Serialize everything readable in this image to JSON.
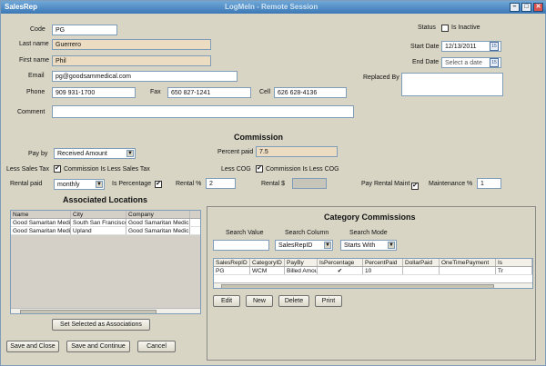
{
  "window": {
    "title": "SalesRep",
    "ghost_title": "LogMeIn - Remote Session"
  },
  "controls": {
    "min": "–",
    "max": "□",
    "close": "✕"
  },
  "form": {
    "code_label": "Code",
    "code_value": "PG",
    "lastname_label": "Last name",
    "lastname_value": "Guerrero",
    "firstname_label": "First name",
    "firstname_value": "Phil",
    "email_label": "Email",
    "email_value": "pg@goodsammedical.com",
    "phone_label": "Phone",
    "phone_value": "909 931-1700",
    "fax_label": "Fax",
    "fax_value": "650 827-1241",
    "cell_label": "Cell",
    "cell_value": "626 628-4136",
    "comment_label": "Comment",
    "comment_value": "",
    "status_label": "Status",
    "inactive_label": "Is Inactive",
    "start_label": "Start Date",
    "start_value": "12/13/2011",
    "end_label": "End Date",
    "end_value": "Select a date",
    "replaced_label": "Replaced By",
    "replaced_value": ""
  },
  "commission": {
    "heading": "Commission",
    "payby_label": "Pay by",
    "payby_value": "Received Amount",
    "percent_paid_label": "Percent paid",
    "percent_paid_value": "7.5",
    "less_sales_tax_label": "Less Sales Tax",
    "commission_less_tax": "Commission Is Less Sales Tax",
    "less_cog_label": "Less COG",
    "commission_less_cog": "Commission Is Less COG",
    "rental_paid_label": "Rental paid",
    "rental_paid_value": "monthly",
    "is_percentage_label": "Is Percentage",
    "rental_pct_label": "Rental %",
    "rental_pct_value": "2",
    "rental_dollar_label": "Rental $",
    "rental_dollar_value": "",
    "pay_rental_maint_label": "Pay Rental Maint",
    "maintenance_label": "Maintenance %",
    "maintenance_value": "1"
  },
  "locations": {
    "heading": "Associated Locations",
    "columns": [
      "Name",
      "City",
      "Company"
    ],
    "rows": [
      [
        "Good Samaritan Medic",
        "South San Francisco",
        "Good Samaritan Medic"
      ],
      [
        "Good Samaritan Medic",
        "Upland",
        "Good Samaritan Medic"
      ]
    ],
    "set_button": "Set Selected as Associations"
  },
  "category": {
    "heading": "Category Commissions",
    "search_value_label": "Search Value",
    "search_value": "",
    "search_column_label": "Search Column",
    "search_column_value": "SalesRepID",
    "search_mode_label": "Search Mode",
    "search_mode_value": "Starts With",
    "columns": [
      "SalesRepID",
      "CategoryID",
      "PayBy",
      "IsPercentage",
      "PercentPaid",
      "DollarPaid",
      "OneTimePayment",
      "Is"
    ],
    "rows": [
      [
        "PG",
        "WCM",
        "Billed Amount",
        "✔",
        "10",
        "",
        "",
        "Tr"
      ]
    ],
    "edit": "Edit",
    "new": "New",
    "delete": "Delete",
    "print": "Print"
  },
  "footer": {
    "save_close": "Save and Close",
    "save_continue": "Save and Continue",
    "cancel": "Cancel"
  }
}
